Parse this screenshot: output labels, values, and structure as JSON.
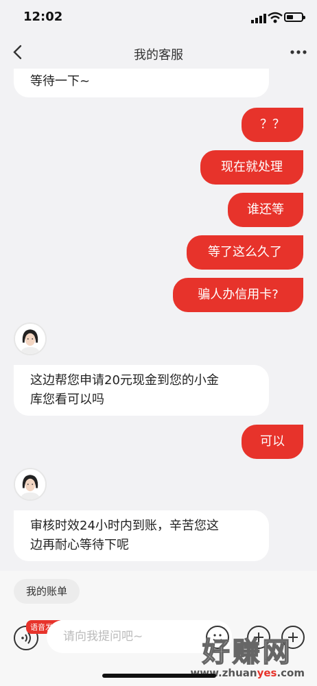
{
  "status_bar": {
    "time": "12:02"
  },
  "header": {
    "title": "我的客服"
  },
  "messages": {
    "m0": "等待一下~",
    "m1": "？？",
    "m2": "现在就处理",
    "m3": "谁还等",
    "m4": "等了这么久了",
    "m5": "骗人办信用卡?",
    "m6_line1": "这边帮您申请20元现金到您的小金",
    "m6_line2": "库您看可以吗",
    "m7": "可以",
    "m8_line1": "审核时效24小时内到账，辛苦您这",
    "m8_line2": "边再耐心等待下呢"
  },
  "bottom": {
    "bill_label": "我的账单",
    "voice_badge": "语音发送",
    "input_placeholder": "请向我提问吧~"
  },
  "watermark": {
    "big": "好赚网",
    "small_a": "www.zhuan",
    "small_b": "yes",
    "small_c": ".com"
  },
  "colors": {
    "accent": "#e7332b",
    "background": "#f2f2f4"
  }
}
